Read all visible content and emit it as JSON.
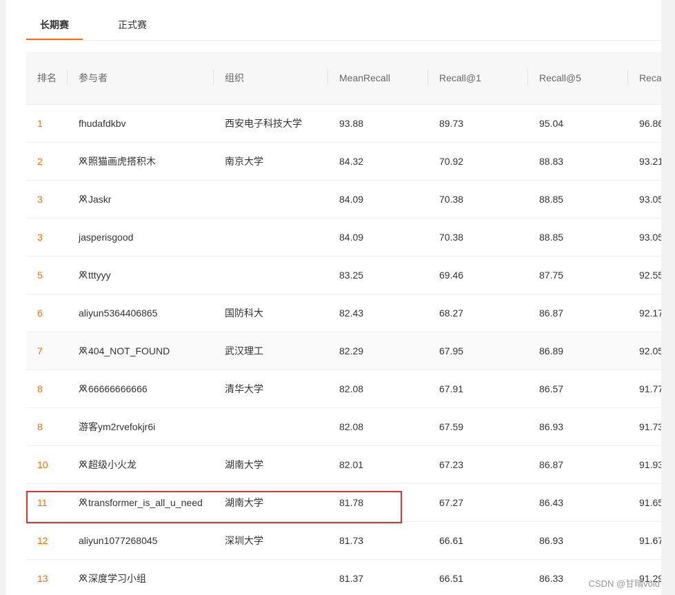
{
  "tabs": [
    {
      "label": "长期赛",
      "active": true
    },
    {
      "label": "正式赛",
      "active": false
    }
  ],
  "columns": [
    "排名",
    "参与者",
    "组织",
    "MeanRecall",
    "Recall@1",
    "Recall@5",
    "Reca"
  ],
  "rows": [
    {
      "rank": "1",
      "name": "fhudafdkbv",
      "team": false,
      "org": "西安电子科技大学",
      "mean": "93.88",
      "r1": "89.73",
      "r5": "95.04",
      "r10": "96.86"
    },
    {
      "rank": "2",
      "name": "照猫画虎搭积木",
      "team": true,
      "org": "南京大学",
      "mean": "84.32",
      "r1": "70.92",
      "r5": "88.83",
      "r10": "93.21"
    },
    {
      "rank": "3",
      "name": "Jaskr",
      "team": true,
      "org": "",
      "mean": "84.09",
      "r1": "70.38",
      "r5": "88.85",
      "r10": "93.05"
    },
    {
      "rank": "3",
      "name": "jasperisgood",
      "team": false,
      "org": "",
      "mean": "84.09",
      "r1": "70.38",
      "r5": "88.85",
      "r10": "93.05"
    },
    {
      "rank": "5",
      "name": "tttyyy",
      "team": true,
      "org": "",
      "mean": "83.25",
      "r1": "69.46",
      "r5": "87.75",
      "r10": "92.55"
    },
    {
      "rank": "6",
      "name": "aliyun5364406865",
      "team": false,
      "org": "国防科大",
      "mean": "82.43",
      "r1": "68.27",
      "r5": "86.87",
      "r10": "92.17"
    },
    {
      "rank": "7",
      "name": "404_NOT_FOUND",
      "team": true,
      "org": "武汉理工",
      "mean": "82.29",
      "r1": "67.95",
      "r5": "86.89",
      "r10": "92.05"
    },
    {
      "rank": "8",
      "name": "66666666666",
      "team": true,
      "org": "清华大学",
      "mean": "82.08",
      "r1": "67.91",
      "r5": "86.57",
      "r10": "91.77"
    },
    {
      "rank": "8",
      "name": "游客ym2rvefokjr6i",
      "team": false,
      "org": "",
      "mean": "82.08",
      "r1": "67.59",
      "r5": "86.93",
      "r10": "91.73"
    },
    {
      "rank": "10",
      "name": "超级小火龙",
      "team": true,
      "org": "湖南大学",
      "mean": "82.01",
      "r1": "67.23",
      "r5": "86.87",
      "r10": "91.93"
    },
    {
      "rank": "11",
      "name": "transformer_is_all_u_need",
      "team": true,
      "org": "湖南大学",
      "mean": "81.78",
      "r1": "67.27",
      "r5": "86.43",
      "r10": "91.65"
    },
    {
      "rank": "12",
      "name": "aliyun1077268045",
      "team": false,
      "org": "深圳大学",
      "mean": "81.73",
      "r1": "66.61",
      "r5": "86.93",
      "r10": "91.67"
    },
    {
      "rank": "13",
      "name": "深度学习小组",
      "team": true,
      "org": "",
      "mean": "81.37",
      "r1": "66.51",
      "r5": "86.33",
      "r10": "91.29"
    }
  ],
  "watermark": "CSDN @甘晴void",
  "colors": {
    "accent": "#ff6a00",
    "highlight": "#e0312f"
  }
}
